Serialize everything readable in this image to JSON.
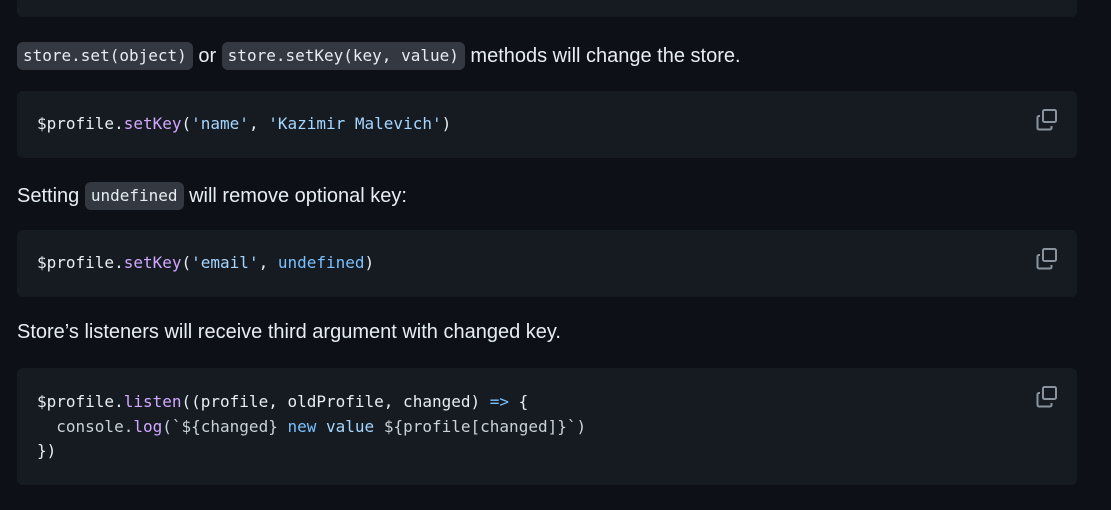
{
  "intro": {
    "code_set": "store.set(object)",
    "or": " or ",
    "code_setkey": "store.setKey(key, value)",
    "suffix": " methods will change the store."
  },
  "block1": {
    "prefix": "$profile.",
    "fn": "setKey",
    "open": "(",
    "arg1": "'name'",
    "sep": ", ",
    "arg2": "'Kazimir Malevich'",
    "close": ")"
  },
  "para2": {
    "prefix": "Setting ",
    "code": "undefined",
    "suffix": " will remove optional key:"
  },
  "block2": {
    "prefix": "$profile.",
    "fn": "setKey",
    "open": "(",
    "arg1": "'email'",
    "sep": ", ",
    "arg2": "undefined",
    "close": ")"
  },
  "para3": {
    "text": "Store’s listeners will receive third argument with changed key."
  },
  "block3": {
    "l1_prefix": "$profile.",
    "l1_fn": "listen",
    "l1_args": "((profile, oldProfile, changed) ",
    "l1_arrow": "=>",
    "l1_brace": " {",
    "l2_indent": "  console.",
    "l2_fn": "log",
    "l2_open": "(`",
    "l2_interp1": "${changed}",
    "l2_sp1": " ",
    "l2_new": "new",
    "l2_sp2": " ",
    "l2_value": "value",
    "l2_sp3": " ",
    "l2_interp2": "${profile[changed]}",
    "l2_close": "`)",
    "l3": "})"
  },
  "copy_icon": "copy-icon"
}
